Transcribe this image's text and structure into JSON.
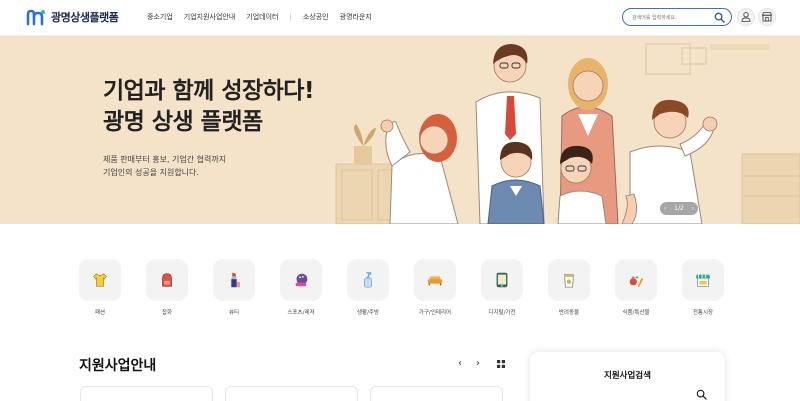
{
  "header": {
    "logo_text": "광명상생플랫폼",
    "nav": [
      "중소기업",
      "기업지원사업안내",
      "기업데이터",
      "소상공인",
      "광명라운지"
    ],
    "nav_separator": "|",
    "search_placeholder": "검색어를 입력하세요.",
    "icons": [
      "search-icon",
      "user-icon",
      "store-icon"
    ]
  },
  "hero": {
    "title_line1": "기업과 함께 성장하다!",
    "title_line2": "광명 상생 플랫폼",
    "sub_line1": "제품 판매부터 홍보, 기업간 협력까지",
    "sub_line2": "기업인의 성공을 지원합니다.",
    "pager_text": "1/2",
    "pager_prev": "‹",
    "pager_next": "›",
    "background_color": "#f4e3c8"
  },
  "categories": [
    {
      "label": "패션",
      "icon": "tshirt-icon"
    },
    {
      "label": "잡화",
      "icon": "backpack-icon"
    },
    {
      "label": "뷰티",
      "icon": "lipstick-icon"
    },
    {
      "label": "스포츠/레저",
      "icon": "bowling-icon"
    },
    {
      "label": "생활/주방",
      "icon": "pump-bottle-icon"
    },
    {
      "label": "가구/인테리어",
      "icon": "sofa-icon"
    },
    {
      "label": "디지털/가전",
      "icon": "tablet-icon"
    },
    {
      "label": "반려동물",
      "icon": "pet-food-icon"
    },
    {
      "label": "식품/특산물",
      "icon": "vegetables-icon"
    },
    {
      "label": "전통시장",
      "icon": "market-stall-icon"
    }
  ],
  "support": {
    "title": "지원사업안내",
    "prev": "‹",
    "next": "›",
    "side_title": "지원사업검색"
  }
}
